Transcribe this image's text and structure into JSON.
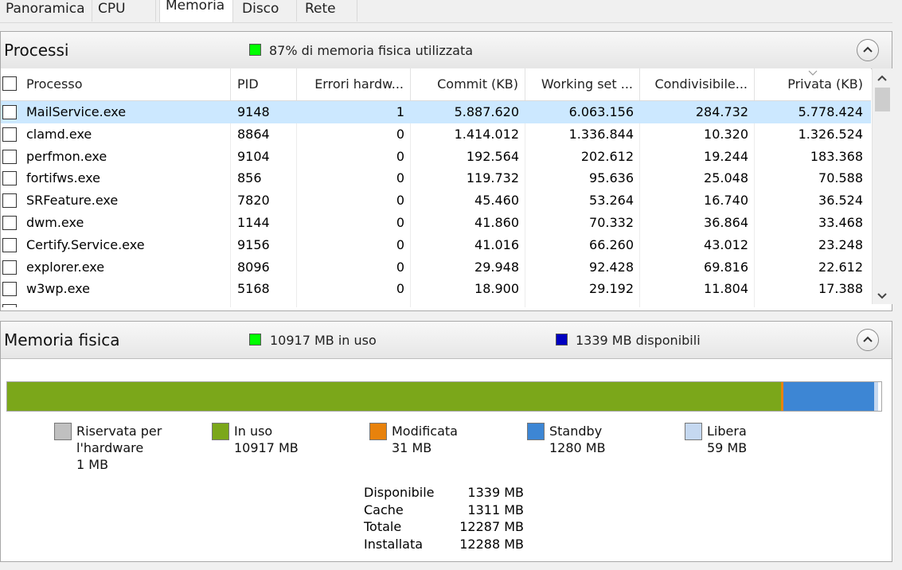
{
  "tabs": [
    "Panoramica",
    "CPU",
    "Memoria",
    "Disco",
    "Rete"
  ],
  "active_tab": "Memoria",
  "processes": {
    "title": "Processi",
    "summary": "87% di memoria fisica utilizzata",
    "summary_color": "#00ff00",
    "columns": [
      "Processo",
      "PID",
      "Errori hardw...",
      "Commit (KB)",
      "Working set ...",
      "Condivisibile...",
      "Privata (KB)"
    ],
    "rows": [
      {
        "name": "MailService.exe",
        "pid": "9148",
        "faults": "1",
        "commit": "5.887.620",
        "working": "6.063.156",
        "shared": "284.732",
        "private": "5.778.424"
      },
      {
        "name": "clamd.exe",
        "pid": "8864",
        "faults": "0",
        "commit": "1.414.012",
        "working": "1.336.844",
        "shared": "10.320",
        "private": "1.326.524"
      },
      {
        "name": "perfmon.exe",
        "pid": "9104",
        "faults": "0",
        "commit": "192.564",
        "working": "202.612",
        "shared": "19.244",
        "private": "183.368"
      },
      {
        "name": "fortifws.exe",
        "pid": "856",
        "faults": "0",
        "commit": "119.732",
        "working": "95.636",
        "shared": "25.048",
        "private": "70.588"
      },
      {
        "name": "SRFeature.exe",
        "pid": "7820",
        "faults": "0",
        "commit": "45.460",
        "working": "53.264",
        "shared": "16.740",
        "private": "36.524"
      },
      {
        "name": "dwm.exe",
        "pid": "1144",
        "faults": "0",
        "commit": "41.860",
        "working": "70.332",
        "shared": "36.864",
        "private": "33.468"
      },
      {
        "name": "Certify.Service.exe",
        "pid": "9156",
        "faults": "0",
        "commit": "41.016",
        "working": "66.260",
        "shared": "43.012",
        "private": "23.248"
      },
      {
        "name": "explorer.exe",
        "pid": "8096",
        "faults": "0",
        "commit": "29.948",
        "working": "92.428",
        "shared": "69.816",
        "private": "22.612"
      },
      {
        "name": "w3wp.exe",
        "pid": "5168",
        "faults": "0",
        "commit": "18.900",
        "working": "29.192",
        "shared": "11.804",
        "private": "17.388"
      },
      {
        "name": "",
        "pid": "",
        "faults": "",
        "commit": "",
        "working": "",
        "shared": "",
        "private": ""
      }
    ]
  },
  "physical": {
    "title": "Memoria fisica",
    "in_use_label": "10917 MB in uso",
    "in_use_color": "#00ff00",
    "available_label": "1339 MB disponibili",
    "available_color": "#0000c0",
    "bar": {
      "in_use_fraction": 0.8855,
      "modified_fraction": 0.0025,
      "standby_fraction": 0.1038,
      "free_fraction": 0.0048,
      "in_use_color": "#7ba71a",
      "modified_color": "#e8820c",
      "standby_color": "#3d86d4",
      "free_color": "#c5d8f0"
    },
    "legend": [
      {
        "label": "Riservata per",
        "label2": "l'hardware",
        "value": "1 MB",
        "color": "#c0c0c0"
      },
      {
        "label": "In uso",
        "value": "10917 MB",
        "color": "#7ba71a"
      },
      {
        "label": "Modificata",
        "value": "31 MB",
        "color": "#e8820c"
      },
      {
        "label": "Standby",
        "value": "1280 MB",
        "color": "#3d86d4"
      },
      {
        "label": "Libera",
        "value": "59 MB",
        "color": "#c5d8f0"
      }
    ],
    "stats": [
      {
        "label": "Disponibile",
        "value": "1339 MB"
      },
      {
        "label": "Cache",
        "value": "1311 MB"
      },
      {
        "label": "Totale",
        "value": "12287 MB"
      },
      {
        "label": "Installata",
        "value": "12288 MB"
      }
    ]
  }
}
